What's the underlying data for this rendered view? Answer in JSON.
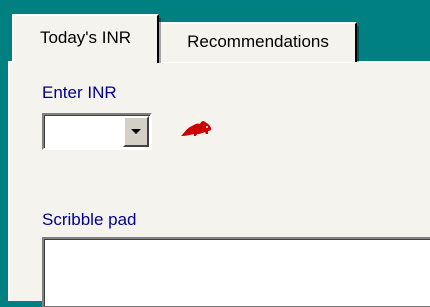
{
  "tabs": [
    {
      "label": "Today's INR",
      "active": true
    },
    {
      "label": "Recommendations",
      "active": false
    }
  ],
  "inr": {
    "label": "Enter INR",
    "value": ""
  },
  "scribble": {
    "label": "Scribble pad",
    "value": ""
  },
  "icons": {
    "rat": "rat-icon"
  },
  "colors": {
    "background": "#008080",
    "panel": "#f4f3ee",
    "label_text": "#00008b",
    "rat_icon": "#cc0000"
  }
}
